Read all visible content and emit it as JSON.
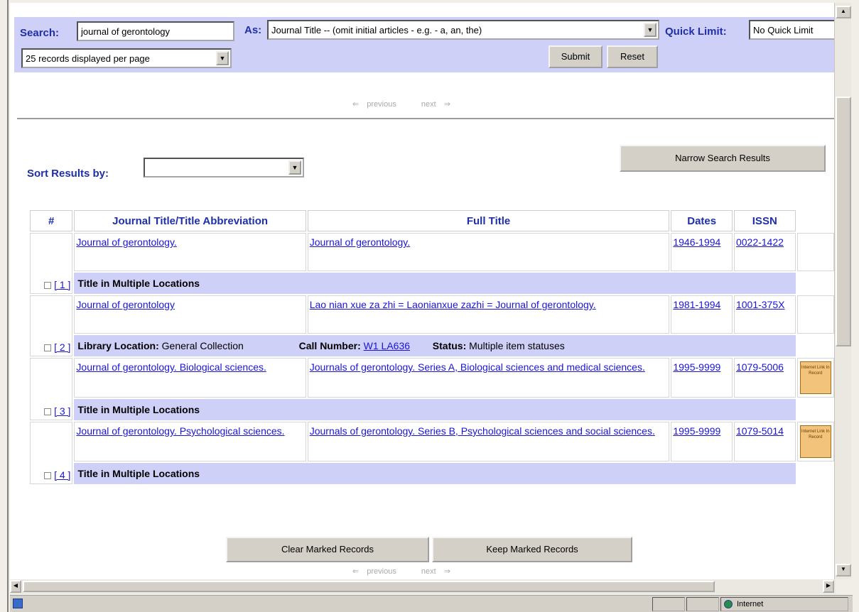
{
  "search": {
    "search_label": "Search:",
    "query": "journal of gerontology",
    "as_label": "As:",
    "as_value": "Journal Title -- (omit initial articles - e.g. - a, an, the)",
    "quick_limit_label": "Quick Limit:",
    "quick_limit_value": "No Quick Limit",
    "per_page": "25 records displayed per page",
    "submit": "Submit",
    "reset": "Reset"
  },
  "pager": {
    "previous": "previous",
    "next": "next"
  },
  "sort": {
    "label": "Sort Results by:",
    "value": ""
  },
  "narrow_button": "Narrow Search Results",
  "table": {
    "headers": [
      "#",
      "Journal Title/Title Abbreviation",
      "Full Title",
      "Dates",
      "ISSN"
    ],
    "rows": [
      {
        "num": "[ 1 ]",
        "title": "Journal of gerontology.",
        "full_title": "Journal of gerontology.",
        "dates": "1946-1994",
        "issn": "0022-1422",
        "sub": "Title in Multiple Locations"
      },
      {
        "num": "[ 2 ]",
        "title": "Journal of gerontology",
        "full_title": "Lao nian xue za zhi = Laonianxue zazhi = Journal of gerontology.",
        "dates": "1981-1994",
        "issn": "1001-375X",
        "location_label": "Library Location:",
        "location": "General Collection",
        "call_label": "Call Number:",
        "call": "W1 LA636",
        "status_label": "Status:",
        "status": "Multiple item statuses"
      },
      {
        "num": "[ 3 ]",
        "title": "Journal of gerontology. Biological sciences.",
        "full_title": "Journals of gerontology. Series A, Biological sciences and medical sciences.",
        "dates": "1995-9999",
        "issn": "1079-5006",
        "sub": "Title in Multiple Locations",
        "badge": "Internet Link In Record"
      },
      {
        "num": "[ 4 ]",
        "title": "Journal of gerontology. Psychological sciences.",
        "full_title": "Journals of gerontology. Series B, Psychological sciences and social sciences.",
        "dates": "1995-9999",
        "issn": "1079-5014",
        "sub": "Title in Multiple Locations",
        "badge": "Internet Link In Record"
      }
    ]
  },
  "clear_marked": "Clear Marked Records",
  "keep_marked": "Keep Marked Records",
  "statusbar": {
    "zone": "Internet"
  }
}
